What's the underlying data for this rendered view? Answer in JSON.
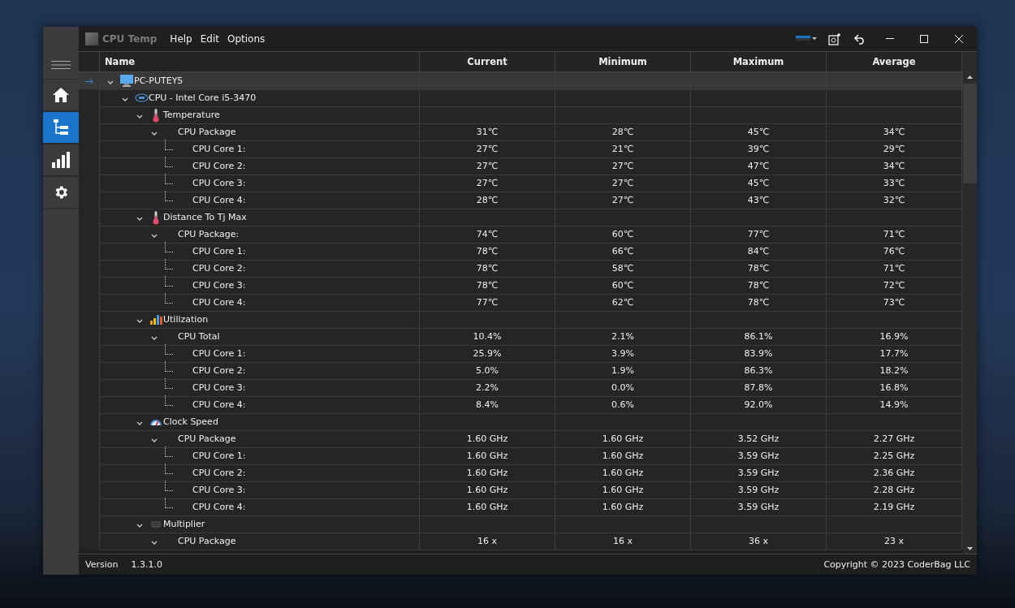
{
  "window": {
    "title": "CPU Temp",
    "menu": [
      "Help",
      "Edit",
      "Options"
    ]
  },
  "sidebar": {
    "items": [
      {
        "kind": "home",
        "selected": false
      },
      {
        "kind": "tree",
        "selected": true
      },
      {
        "kind": "chart",
        "selected": false
      },
      {
        "kind": "settings",
        "selected": false
      }
    ]
  },
  "table": {
    "columns": [
      "Name",
      "Current",
      "Minimum",
      "Maximum",
      "Average"
    ],
    "rows": [
      {
        "name": "PC-PUTEY5",
        "kind": "computer",
        "selected": true,
        "expanded": true,
        "children": [
          {
            "name": "CPU - Intel Core i5-3470",
            "kind": "cpu",
            "selected": false,
            "expanded": true,
            "children": [
              {
                "name": "Temperature",
                "kind": "temperature",
                "selected": false,
                "expanded": true,
                "children": [
                  {
                    "name": "CPU Package",
                    "selected": false,
                    "expanded": true,
                    "values": [
                      "31℃",
                      "28℃",
                      "45℃",
                      "34℃"
                    ],
                    "children": [
                      {
                        "name": "CPU Core 1:",
                        "selected": false,
                        "values": [
                          "27℃",
                          "21℃",
                          "39℃",
                          "29℃"
                        ]
                      },
                      {
                        "name": "CPU Core 2:",
                        "selected": false,
                        "values": [
                          "27℃",
                          "27℃",
                          "47℃",
                          "34℃"
                        ]
                      },
                      {
                        "name": "CPU Core 3:",
                        "selected": false,
                        "values": [
                          "27℃",
                          "27℃",
                          "45℃",
                          "33℃"
                        ]
                      },
                      {
                        "name": "CPU Core 4:",
                        "selected": false,
                        "values": [
                          "28℃",
                          "27℃",
                          "43℃",
                          "32℃"
                        ]
                      }
                    ]
                  }
                ]
              },
              {
                "name": "Distance To Tj Max",
                "kind": "temperature",
                "selected": false,
                "expanded": true,
                "children": [
                  {
                    "name": "CPU Package:",
                    "selected": false,
                    "expanded": true,
                    "values": [
                      "74℃",
                      "60℃",
                      "77℃",
                      "71℃"
                    ],
                    "children": [
                      {
                        "name": "CPU Core 1:",
                        "selected": false,
                        "values": [
                          "78℃",
                          "66℃",
                          "84℃",
                          "76℃"
                        ]
                      },
                      {
                        "name": "CPU Core 2:",
                        "selected": false,
                        "values": [
                          "78℃",
                          "58℃",
                          "78℃",
                          "71℃"
                        ]
                      },
                      {
                        "name": "CPU Core 3:",
                        "selected": false,
                        "values": [
                          "78℃",
                          "60℃",
                          "78℃",
                          "72℃"
                        ]
                      },
                      {
                        "name": "CPU Core 4:",
                        "selected": false,
                        "values": [
                          "77℃",
                          "62℃",
                          "78℃",
                          "73℃"
                        ]
                      }
                    ]
                  }
                ]
              },
              {
                "name": "Utilization",
                "kind": "utilization",
                "selected": false,
                "expanded": true,
                "children": [
                  {
                    "name": "CPU Total",
                    "selected": false,
                    "expanded": true,
                    "values": [
                      "10.4%",
                      "2.1%",
                      "86.1%",
                      "16.9%"
                    ],
                    "children": [
                      {
                        "name": "CPU Core 1:",
                        "selected": false,
                        "values": [
                          "25.9%",
                          "3.9%",
                          "83.9%",
                          "17.7%"
                        ]
                      },
                      {
                        "name": "CPU Core 2:",
                        "selected": false,
                        "values": [
                          "5.0%",
                          "1.9%",
                          "86.3%",
                          "18.2%"
                        ]
                      },
                      {
                        "name": "CPU Core 3:",
                        "selected": false,
                        "values": [
                          "2.2%",
                          "0.0%",
                          "87.8%",
                          "16.8%"
                        ]
                      },
                      {
                        "name": "CPU Core 4:",
                        "selected": false,
                        "values": [
                          "8.4%",
                          "0.6%",
                          "92.0%",
                          "14.9%"
                        ]
                      }
                    ]
                  }
                ]
              },
              {
                "name": "Clock Speed",
                "kind": "clock",
                "selected": false,
                "expanded": true,
                "children": [
                  {
                    "name": "CPU Package",
                    "selected": false,
                    "expanded": true,
                    "values": [
                      "1.60 GHz",
                      "1.60 GHz",
                      "3.52 GHz",
                      "2.27 GHz"
                    ],
                    "children": [
                      {
                        "name": "CPU Core 1:",
                        "selected": false,
                        "values": [
                          "1.60 GHz",
                          "1.60 GHz",
                          "3.59 GHz",
                          "2.25 GHz"
                        ]
                      },
                      {
                        "name": "CPU Core 2:",
                        "selected": false,
                        "values": [
                          "1.60 GHz",
                          "1.60 GHz",
                          "3.59 GHz",
                          "2.36 GHz"
                        ]
                      },
                      {
                        "name": "CPU Core 3:",
                        "selected": false,
                        "values": [
                          "1.60 GHz",
                          "1.60 GHz",
                          "3.59 GHz",
                          "2.28 GHz"
                        ]
                      },
                      {
                        "name": "CPU Core 4:",
                        "selected": false,
                        "values": [
                          "1.60 GHz",
                          "1.60 GHz",
                          "3.59 GHz",
                          "2.19 GHz"
                        ]
                      }
                    ]
                  }
                ]
              },
              {
                "name": "Multiplier",
                "kind": "multiplier",
                "selected": false,
                "expanded": true,
                "children": [
                  {
                    "name": "CPU Package",
                    "selected": false,
                    "expanded": true,
                    "values": [
                      "16 x",
                      "16 x",
                      "36 x",
                      "23 x"
                    ]
                  }
                ]
              }
            ]
          }
        ]
      }
    ]
  },
  "status_bar": {
    "label": "Version",
    "version": "1.3.1.0",
    "copyright": "Copyright © 2023 CoderBag LLC"
  }
}
